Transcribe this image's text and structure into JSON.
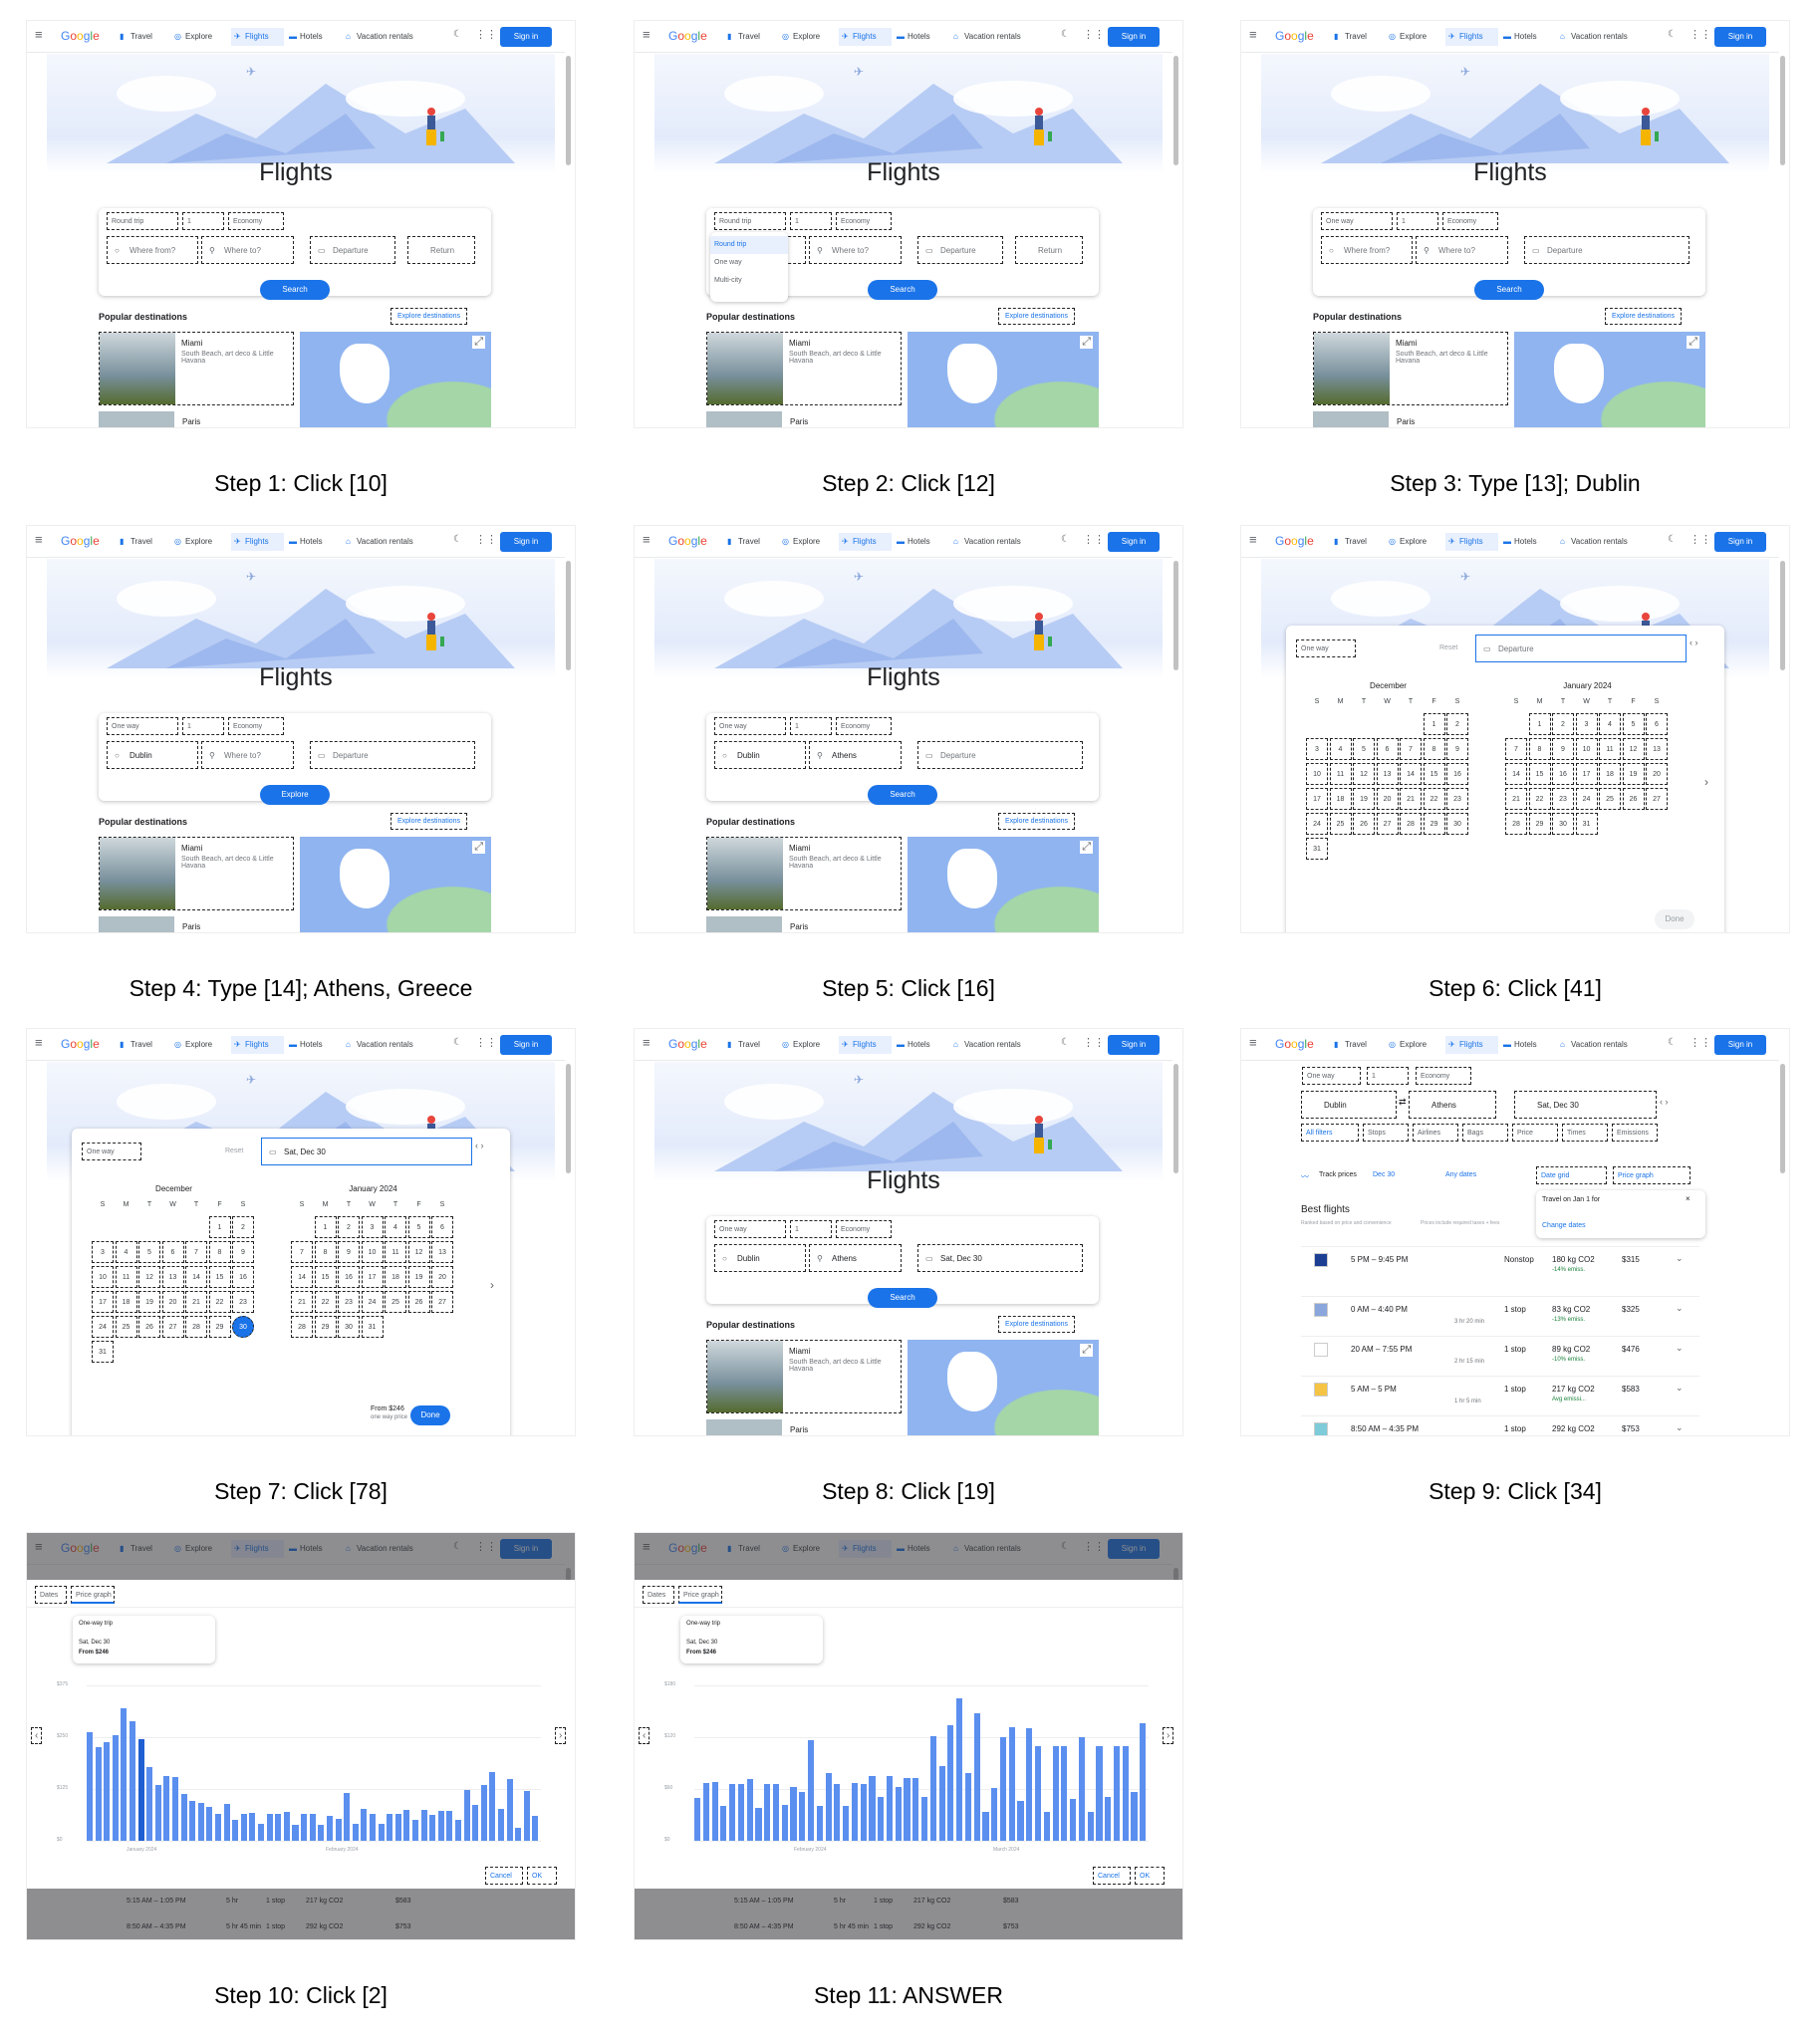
{
  "nav": {
    "logo": "Google",
    "items": [
      "Travel",
      "Explore",
      "Flights",
      "Hotels",
      "Vacation rentals"
    ],
    "icons": [
      "luggage-icon",
      "explore-icon",
      "plane-icon",
      "bed-icon",
      "house-icon"
    ],
    "sign_in": "Sign in"
  },
  "home": {
    "title": "Flights",
    "popular": "Popular destinations",
    "explore": "Explore destinations",
    "cards": [
      {
        "city": "Miami",
        "desc": "South Beach, art deco & Little Havana"
      },
      {
        "city": "Paris"
      }
    ]
  },
  "calendar": {
    "weekdays": [
      "S",
      "M",
      "T",
      "W",
      "T",
      "F",
      "S"
    ],
    "months": [
      {
        "name": "December",
        "start": 5,
        "days": 31
      },
      {
        "name": "January 2024",
        "start": 1,
        "days": 31
      }
    ]
  },
  "colors": {
    "accent": "#1a73e8",
    "bar": "#5b8fef",
    "bar_selected": "#1f5fd1"
  },
  "steps": [
    {
      "caption": "Step 1: Click [10]",
      "view": "home",
      "trip": "Round trip",
      "pax": "1",
      "cabin": "Economy",
      "from_ph": "Where from?",
      "to_ph": "Where to?",
      "dep_ph": "Departure",
      "ret_ph": "Return",
      "button": "Search"
    },
    {
      "caption": "Step 2: Click [12]",
      "view": "home",
      "trip": "Round trip",
      "pax": "1",
      "cabin": "Economy",
      "from_ph": "Where from?",
      "to_ph": "Where to?",
      "dep_ph": "Departure",
      "ret_ph": "Return",
      "button": "Search",
      "menu": [
        "Round trip",
        "One way",
        "Multi-city"
      ]
    },
    {
      "caption": "Step 3: Type [13]; Dublin",
      "view": "home",
      "trip": "One way",
      "pax": "1",
      "cabin": "Economy",
      "from_ph": "Where from?",
      "to_ph": "Where to?",
      "dep_ph": "Departure",
      "button": "Search"
    },
    {
      "caption": "Step 4: Type [14]; Athens, Greece",
      "view": "home",
      "trip": "One way",
      "pax": "1",
      "cabin": "Economy",
      "from": "Dublin",
      "to_ph": "Where to?",
      "dep_ph": "Departure",
      "button": "Explore"
    },
    {
      "caption": "Step 5: Click [16]",
      "view": "home",
      "trip": "One way",
      "pax": "1",
      "cabin": "Economy",
      "from": "Dublin",
      "to": "Athens",
      "dep_ph": "Departure",
      "button": "Search"
    },
    {
      "caption": "Step 6: Click [41]",
      "view": "calendar",
      "trip": "One way",
      "reset": "Reset",
      "dep_ph": "Departure",
      "done": "Done"
    },
    {
      "caption": "Step 7: Click [78]",
      "view": "calendar",
      "trip": "One way",
      "reset": "Reset",
      "dep": "Sat, Dec 30",
      "selected": 30,
      "from_price": "From $246",
      "price_note": "one way price",
      "done": "Done"
    },
    {
      "caption": "Step 8: Click [19]",
      "view": "home",
      "trip": "One way",
      "pax": "1",
      "cabin": "Economy",
      "from": "Dublin",
      "to": "Athens",
      "dep": "Sat, Dec 30",
      "button": "Search"
    },
    {
      "caption": "Step 9: Click [34]",
      "view": "results",
      "trip": "One way",
      "pax": "1",
      "cabin": "Economy",
      "from": "Dublin",
      "to": "Athens",
      "dep": "Sat, Dec 30",
      "filters": [
        "All filters",
        "Stops",
        "Airlines",
        "Bags",
        "Price",
        "Times",
        "Emissions"
      ],
      "track": "Track prices",
      "date_chip": "Dec 30",
      "any_dates": "Any dates",
      "date_grid": "Date grid",
      "price_graph": "Price graph",
      "popup": {
        "text": "Travel on Jan 1 for",
        "link": "Change dates"
      },
      "best": "Best flights",
      "ranked": "Ranked based on price and convenience",
      "prices_note": "Prices include required taxes + fees",
      "flights": [
        {
          "times": "5 PM – 9:45 PM",
          "dur": "",
          "stops": "Nonstop",
          "co2": "180 kg CO2",
          "emis": "-14% emiss.",
          "price": "$315"
        },
        {
          "times": "0 AM – 4:40 PM",
          "dur": "3 hr 20 min",
          "stops": "1 stop",
          "co2": "83 kg CO2",
          "emis": "-13% emiss.",
          "price": "$325"
        },
        {
          "times": "20 AM – 7:55 PM",
          "dur": "2 hr 15 min",
          "stops": "1 stop",
          "co2": "89 kg CO2",
          "emis": "-10% emiss.",
          "price": "$476"
        },
        {
          "times": "5 AM – 5 PM",
          "dur": "1 hr 5 min",
          "stops": "1 stop",
          "co2": "217 kg CO2",
          "emis": "Avg emissi...",
          "price": "$583"
        },
        {
          "times": "8:50 AM – 4:35 PM",
          "dur": "5 hr 45 min",
          "stops": "1 stop",
          "co2": "292 kg CO2",
          "emis": "",
          "price": "$753"
        }
      ]
    },
    {
      "caption": "Step 10: Click [2]",
      "view": "graph",
      "chart": 0
    },
    {
      "caption": "Step 11: ANSWER",
      "view": "graph",
      "chart": 1
    }
  ],
  "graph": {
    "tabs": [
      "Dates",
      "Price graph"
    ],
    "tooltip": {
      "trip": "One-way trip",
      "date": "Sat, Dec 30",
      "price": "From $246"
    },
    "cancel": "Cancel",
    "ok": "OK",
    "bg_rows": [
      {
        "times": "5:15 AM – 1:05 PM",
        "dur": "5 hr",
        "stops": "1 stop",
        "co2": "217 kg CO2",
        "price": "$583"
      },
      {
        "times": "8:50 AM – 4:35 PM",
        "dur": "5 hr 45 min",
        "stops": "1 stop",
        "co2": "292 kg CO2",
        "price": "$753"
      }
    ]
  },
  "chart_data": [
    {
      "type": "bar",
      "ylim": [
        0,
        375
      ],
      "yticks": [
        "$375",
        "$250",
        "$125",
        "$0"
      ],
      "xlabels": [
        "January 2024",
        "February 2024"
      ],
      "selected_index": 6,
      "values": [
        262,
        225,
        239,
        256,
        320,
        289,
        245,
        179,
        134,
        156,
        154,
        112,
        95,
        92,
        82,
        64,
        88,
        50,
        66,
        68,
        40,
        64,
        64,
        70,
        38,
        64,
        64,
        39,
        60,
        54,
        116,
        40,
        78,
        66,
        40,
        66,
        66,
        74,
        50,
        74,
        62,
        72,
        72,
        51,
        122,
        86,
        134,
        165,
        78,
        148,
        32,
        120,
        60
      ]
    },
    {
      "type": "bar",
      "ylim": [
        0,
        180
      ],
      "yticks": [
        "$180",
        "$120",
        "$60",
        "$0"
      ],
      "xlabels": [
        "February 2024",
        "March 2024"
      ],
      "values": [
        50,
        67,
        68,
        40,
        66,
        66,
        72,
        38,
        66,
        66,
        41,
        62,
        56,
        117,
        40,
        79,
        66,
        40,
        67,
        66,
        75,
        51,
        75,
        62,
        73,
        73,
        51,
        121,
        87,
        134,
        165,
        78,
        148,
        33,
        61,
        120,
        131,
        46,
        130,
        110,
        33,
        110,
        110,
        49,
        120,
        34,
        110,
        51,
        110,
        110,
        56,
        136
      ]
    }
  ]
}
